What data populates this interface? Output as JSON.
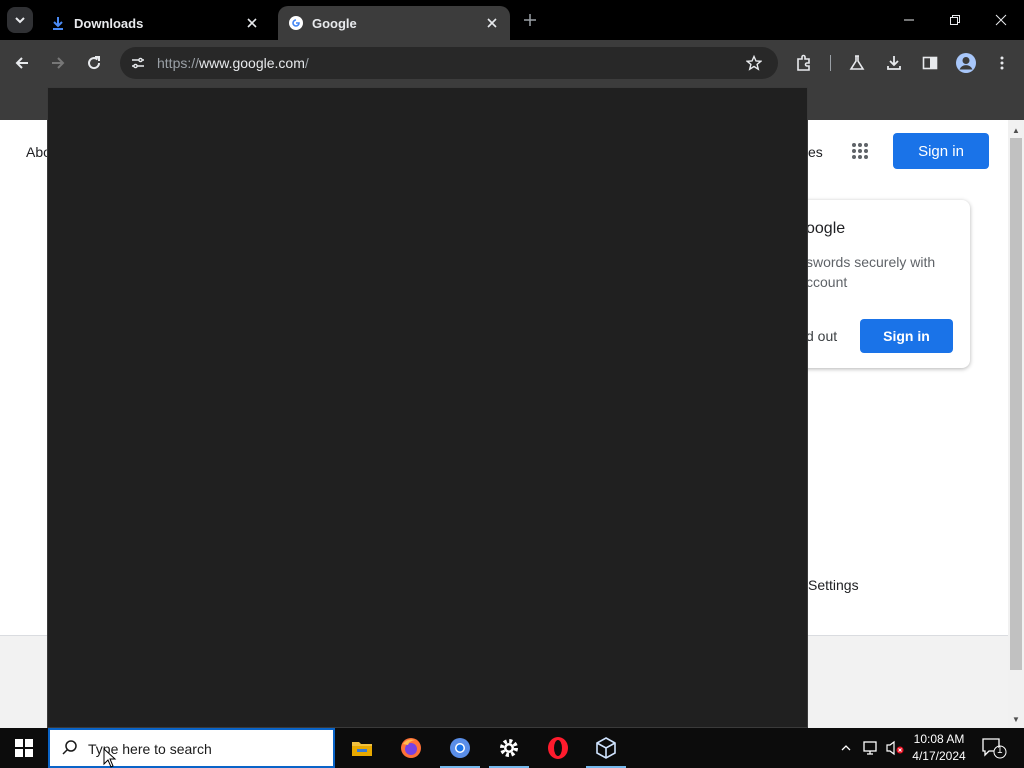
{
  "tabs": [
    {
      "title": "Downloads",
      "icon": "download-icon"
    },
    {
      "title": "Google",
      "icon": "google-g-icon",
      "active": true
    }
  ],
  "toolbar": {
    "url_prefix": "https://",
    "url_host": "www.google.com",
    "url_suffix": "/"
  },
  "page": {
    "about_link": "Abo",
    "images_link": "es",
    "signin_label": "Sign in",
    "card": {
      "title": "oogle",
      "body": "swords securely with ccount",
      "stay_out": "d out",
      "signin_label": "Sign in"
    },
    "footer_settings": "Settings"
  },
  "taskbar": {
    "search_placeholder": "Type here to search",
    "apps": [
      "file-explorer-icon",
      "firefox-icon",
      "chrome-icon",
      "settings-gear-icon",
      "opera-icon",
      "virtualbox-icon"
    ],
    "clock_time": "10:08 AM",
    "clock_date": "4/17/2024",
    "notification_count": "1"
  },
  "colors": {
    "chrome_dark": "#3c3c3c",
    "tabstrip": "#000000",
    "accent_blue": "#1a73e8",
    "popup_bg": "#202020",
    "taskbar_bg": "#0c0c0c"
  }
}
